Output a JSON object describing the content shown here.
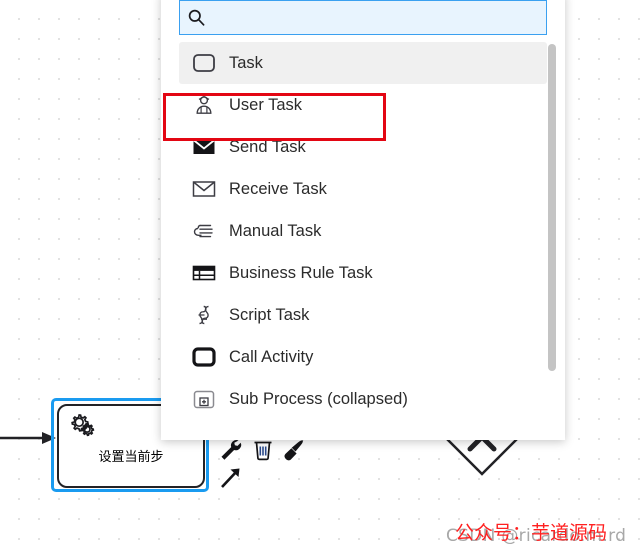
{
  "canvas": {
    "task_shape": {
      "label": "设置当前步",
      "icon": "gear-icon",
      "selected_color": "#1a9bf0",
      "border_color": "#222226"
    },
    "gateway": {
      "icon": "exclusive-gateway-diamond"
    },
    "context_pad": {
      "items": [
        {
          "name": "wrench-icon",
          "title": "Change type"
        },
        {
          "name": "trash-icon",
          "title": "Remove"
        },
        {
          "name": "paintbrush-icon",
          "title": "Set color"
        },
        {
          "name": "connect-arrow-icon",
          "title": "Connect"
        }
      ]
    }
  },
  "popup": {
    "search": {
      "value": "",
      "placeholder": "",
      "icon": "search-icon",
      "border_color": "#3aa0f0",
      "background_color": "#e8f4fe"
    },
    "entries": [
      {
        "label": "Task",
        "icon": "task-icon",
        "hovered": true
      },
      {
        "label": "User Task",
        "icon": "user-task-icon",
        "hovered": false
      },
      {
        "label": "Send Task",
        "icon": "send-task-icon",
        "hovered": false
      },
      {
        "label": "Receive Task",
        "icon": "receive-task-icon",
        "hovered": false
      },
      {
        "label": "Manual Task",
        "icon": "manual-task-icon",
        "hovered": false
      },
      {
        "label": "Business Rule Task",
        "icon": "business-rule-task-icon",
        "hovered": false
      },
      {
        "label": "Script Task",
        "icon": "script-task-icon",
        "hovered": false
      },
      {
        "label": "Call Activity",
        "icon": "call-activity-icon",
        "hovered": false
      },
      {
        "label": "Sub Process (collapsed)",
        "icon": "sub-process-collapsed-icon",
        "hovered": false
      }
    ],
    "scrollbar": {
      "thumb_color": "#c4c4c4"
    }
  },
  "annotation": {
    "target_label": "User Task",
    "color": "#e30613"
  },
  "watermarks": {
    "gray_text": "CSDN @ricardo.m.rd",
    "red_text": "公众号：芋道源码"
  }
}
